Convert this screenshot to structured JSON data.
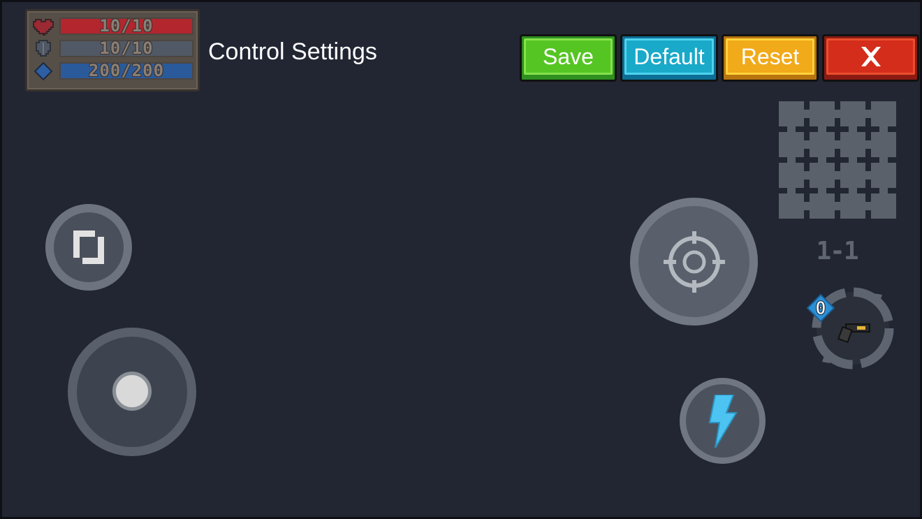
{
  "hud": {
    "health": {
      "text": "10/10",
      "value": 10,
      "max": 10,
      "color": "#b3262e"
    },
    "armor": {
      "text": "10/10",
      "value": 10,
      "max": 10,
      "color": "#505965"
    },
    "energy": {
      "text": "200/200",
      "value": 200,
      "max": 200,
      "color": "#2a5a9a"
    }
  },
  "title": "Control Settings",
  "buttons": {
    "save": "Save",
    "default": "Default",
    "reset": "Reset",
    "close": "✕"
  },
  "level": "1-1",
  "weapon": {
    "energy_cost": "0",
    "icon": "pistol-icon"
  },
  "colors": {
    "background": "#222633",
    "save": "#55c523",
    "default": "#19a9c9",
    "reset": "#f1aa1a",
    "close": "#d42d1b",
    "skill": "#4cc3f0"
  }
}
